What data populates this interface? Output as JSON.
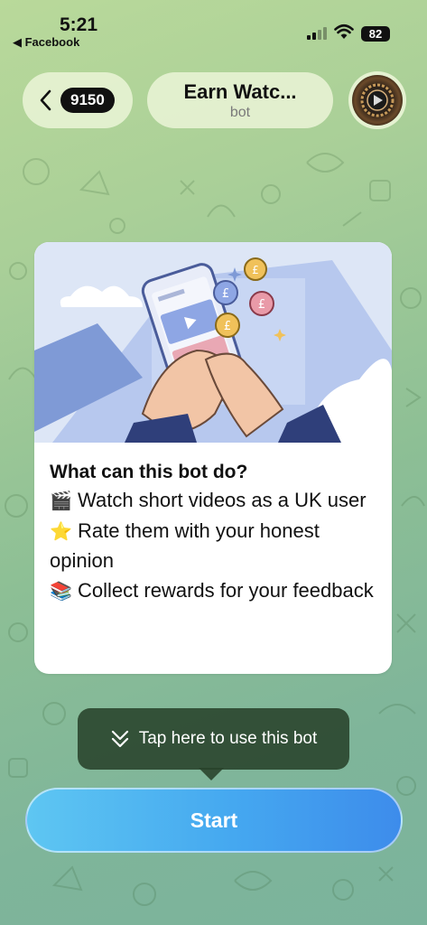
{
  "status_bar": {
    "time": "5:21",
    "back_app": "◀ Facebook",
    "battery": "82"
  },
  "header": {
    "back_count": "9150",
    "title": "Earn Watc...",
    "subtitle": "bot"
  },
  "card": {
    "heading": "What can this bot do?",
    "features": [
      {
        "emoji": "🎬",
        "text": "Watch short videos as a UK user"
      },
      {
        "emoji": "⭐",
        "text": "Rate them with your honest opinion"
      },
      {
        "emoji": "📚",
        "text": "Collect rewards for your feedback"
      }
    ]
  },
  "tooltip": {
    "text": "Tap here to use this bot"
  },
  "start_button": {
    "label": "Start"
  },
  "colors": {
    "accent": "#45a8f0",
    "tooltip_bg": "#28422a",
    "pill_bg": "#ebf5d7"
  }
}
